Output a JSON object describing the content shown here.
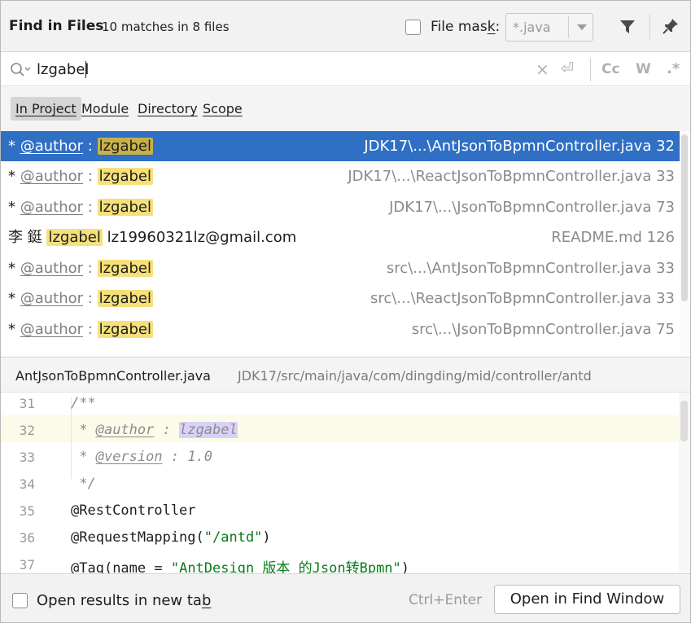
{
  "header": {
    "title": "Find in Files",
    "summary": "10 matches in 8 files",
    "file_mask_label_pre": "File mas",
    "file_mask_label_key": "k",
    "file_mask_label_post": ":",
    "file_mask_value": "*.java"
  },
  "search": {
    "query": "lzgabel",
    "regex_label": ".*",
    "case_label": "Cc",
    "words_label": "W"
  },
  "scopes": [
    {
      "label": "In Project",
      "active": true
    },
    {
      "label": "Module",
      "active": false
    },
    {
      "label": "Directory",
      "active": false
    },
    {
      "label": "Scope",
      "active": false
    }
  ],
  "results": [
    {
      "prefix": "* ",
      "tag": "@author",
      "sep": " : ",
      "match": "lzgabel",
      "suffix": "",
      "location": "JDK17\\...\\AntJsonToBpmnController.java 32",
      "selected": true
    },
    {
      "prefix": "* ",
      "tag": "@author",
      "sep": " : ",
      "match": "lzgabel",
      "suffix": "",
      "location": "JDK17\\...\\ReactJsonToBpmnController.java 33",
      "selected": false
    },
    {
      "prefix": "* ",
      "tag": "@author",
      "sep": " : ",
      "match": "lzgabel",
      "suffix": "",
      "location": "JDK17\\...\\JsonToBpmnController.java 73",
      "selected": false
    },
    {
      "prefix": "李 鋌 ",
      "tag": "",
      "sep": "",
      "match": "lzgabel",
      "suffix": "  lz19960321lz@gmail.com",
      "location": "README.md 126",
      "selected": false
    },
    {
      "prefix": "* ",
      "tag": "@author",
      "sep": " : ",
      "match": "lzgabel",
      "suffix": "",
      "location": "src\\...\\AntJsonToBpmnController.java 33",
      "selected": false
    },
    {
      "prefix": "* ",
      "tag": "@author",
      "sep": " : ",
      "match": "lzgabel",
      "suffix": "",
      "location": "src\\...\\ReactJsonToBpmnController.java 33",
      "selected": false
    },
    {
      "prefix": "* ",
      "tag": "@author",
      "sep": " : ",
      "match": "lzgabel",
      "suffix": "",
      "location": "src\\...\\JsonToBpmnController.java 75",
      "selected": false
    }
  ],
  "preview": {
    "file_name": "AntJsonToBpmnController.java",
    "file_path": "JDK17/src/main/java/com/dingding/mid/controller/antd",
    "lines": [
      {
        "num": "31"
      },
      {
        "num": "32"
      },
      {
        "num": "33"
      },
      {
        "num": "34"
      },
      {
        "num": "35"
      },
      {
        "num": "36"
      },
      {
        "num": "37"
      }
    ],
    "code": {
      "l31": "/**",
      "l32_star": " * ",
      "l32_tag": "@author",
      "l32_sep": " : ",
      "l32_match": "lzgabel",
      "l33_star": " * ",
      "l33_tag": "@version",
      "l33_rest": " : 1.0",
      "l34": " */",
      "l35": "@RestController",
      "l36_a": "@RequestMapping(",
      "l36_s": "\"/antd\"",
      "l36_b": ")",
      "l37_a": "@Tag(",
      "l37_n": "name = ",
      "l37_s": "\"AntDesign 版本 的Json转Bpmn\"",
      "l37_b": ")"
    }
  },
  "footer": {
    "open_new_tab_pre": "Open results in new ta",
    "open_new_tab_key": "b",
    "shortcut": "Ctrl+Enter",
    "open_button": "Open in Find Window"
  }
}
